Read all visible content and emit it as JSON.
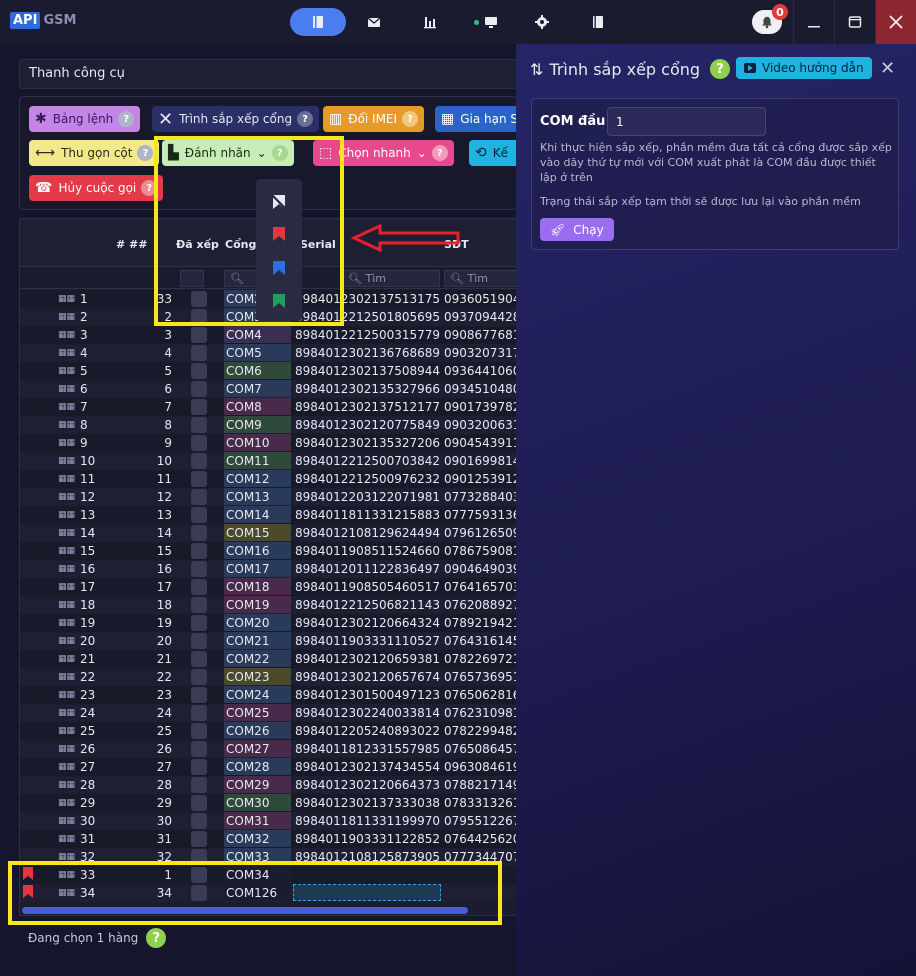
{
  "app": {
    "logo_a": "API",
    "logo_b": "GSM",
    "notifications": "0"
  },
  "toolbar": {
    "title": "Thanh công cụ"
  },
  "buttons": {
    "cmd_table": "Bảng lệnh",
    "port_sort": "Trình sắp xếp cổng",
    "change_imei": "Đổi IMEI",
    "limit": "Gia hạn S",
    "collapse": "Thu gọn cột",
    "label": "Đánh nhãn",
    "quick_select": "Chọn nhanh",
    "extra": "Kế",
    "cancel_call": "Hủy cuộc gọi",
    "help": "?"
  },
  "grid": {
    "headers": {
      "idx": "# ##",
      "sorted": "Đã xếp",
      "port": "Cổng",
      "serial": "Serial",
      "phone": "SĐT"
    },
    "search_placeholder": "Tìm",
    "rows": [
      {
        "i": "1",
        "s": "33",
        "com": "COM2",
        "serial": "8984012302137513175",
        "phone": "0936051904",
        "cc": "#2a3a5a"
      },
      {
        "i": "2",
        "s": "2",
        "com": "COM3",
        "serial": "8984012212501805695",
        "phone": "0937094428",
        "cc": "#2a3a5a"
      },
      {
        "i": "3",
        "s": "3",
        "com": "COM4",
        "serial": "8984012212500315779",
        "phone": "0908677681",
        "cc": "#3a2f50"
      },
      {
        "i": "4",
        "s": "4",
        "com": "COM5",
        "serial": "8984012302136768689",
        "phone": "0903207317",
        "cc": "#2a3a5a"
      },
      {
        "i": "5",
        "s": "5",
        "com": "COM6",
        "serial": "8984012302137508944",
        "phone": "0936441060",
        "cc": "#2f4a3a"
      },
      {
        "i": "6",
        "s": "6",
        "com": "COM7",
        "serial": "8984012302135327966",
        "phone": "0934510480",
        "cc": "#2a3a5a"
      },
      {
        "i": "7",
        "s": "7",
        "com": "COM8",
        "serial": "8984012302137512177",
        "phone": "0901739782",
        "cc": "#4a2a4a"
      },
      {
        "i": "8",
        "s": "8",
        "com": "COM9",
        "serial": "8984012302120775849",
        "phone": "0903200631",
        "cc": "#2f4a3a"
      },
      {
        "i": "9",
        "s": "9",
        "com": "COM10",
        "serial": "8984012302135327206",
        "phone": "0904543911",
        "cc": "#4a2a4a"
      },
      {
        "i": "10",
        "s": "10",
        "com": "COM11",
        "serial": "8984012212500703842",
        "phone": "0901699814",
        "cc": "#2f4a3a"
      },
      {
        "i": "11",
        "s": "11",
        "com": "COM12",
        "serial": "8984012212500976232",
        "phone": "0901253912",
        "cc": "#2a3a5a"
      },
      {
        "i": "12",
        "s": "12",
        "com": "COM13",
        "serial": "8984012203122071981",
        "phone": "0773288403",
        "cc": "#2a3a5a"
      },
      {
        "i": "13",
        "s": "13",
        "com": "COM14",
        "serial": "8984011811331215883",
        "phone": "0777593136",
        "cc": "#2a3a5a"
      },
      {
        "i": "14",
        "s": "14",
        "com": "COM15",
        "serial": "8984012108129624494",
        "phone": "0796126509",
        "cc": "#4a4a2a"
      },
      {
        "i": "15",
        "s": "15",
        "com": "COM16",
        "serial": "8984011908511524660",
        "phone": "0786759081",
        "cc": "#2a3a5a"
      },
      {
        "i": "16",
        "s": "16",
        "com": "COM17",
        "serial": "8984012011122836497",
        "phone": "0904649039",
        "cc": "#2a3a5a"
      },
      {
        "i": "17",
        "s": "17",
        "com": "COM18",
        "serial": "8984011908505460517",
        "phone": "0764165703",
        "cc": "#4a2a4a"
      },
      {
        "i": "18",
        "s": "18",
        "com": "COM19",
        "serial": "8984012212506821143",
        "phone": "0762088927",
        "cc": "#4a2a4a"
      },
      {
        "i": "19",
        "s": "19",
        "com": "COM20",
        "serial": "8984012302120664324",
        "phone": "0789219421",
        "cc": "#2a3a5a"
      },
      {
        "i": "20",
        "s": "20",
        "com": "COM21",
        "serial": "8984011903331110527",
        "phone": "0764316145",
        "cc": "#2a3a5a"
      },
      {
        "i": "21",
        "s": "21",
        "com": "COM22",
        "serial": "8984012302120659381",
        "phone": "0782269721",
        "cc": "#2a3a5a"
      },
      {
        "i": "22",
        "s": "22",
        "com": "COM23",
        "serial": "8984012302120657674",
        "phone": "0765736951",
        "cc": "#4a4a2a"
      },
      {
        "i": "23",
        "s": "23",
        "com": "COM24",
        "serial": "8984012301500497123",
        "phone": "0765062816",
        "cc": "#2a3a5a"
      },
      {
        "i": "24",
        "s": "24",
        "com": "COM25",
        "serial": "8984012302240033814",
        "phone": "0762310981",
        "cc": "#4a2a4a"
      },
      {
        "i": "25",
        "s": "25",
        "com": "COM26",
        "serial": "8984012205240893022",
        "phone": "0782299482",
        "cc": "#2a3a5a"
      },
      {
        "i": "26",
        "s": "26",
        "com": "COM27",
        "serial": "8984011812331557985",
        "phone": "0765086457",
        "cc": "#4a2a4a"
      },
      {
        "i": "27",
        "s": "27",
        "com": "COM28",
        "serial": "8984012302137434554",
        "phone": "0963084619",
        "cc": "#2a3a5a"
      },
      {
        "i": "28",
        "s": "28",
        "com": "COM29",
        "serial": "8984012302120664373",
        "phone": "0788217149",
        "cc": "#4a2a4a"
      },
      {
        "i": "29",
        "s": "29",
        "com": "COM30",
        "serial": "8984012302137333038",
        "phone": "0783313261",
        "cc": "#2f4a3a"
      },
      {
        "i": "30",
        "s": "30",
        "com": "COM31",
        "serial": "8984011811331199970",
        "phone": "0795512267",
        "cc": "#4a2a4a"
      },
      {
        "i": "31",
        "s": "31",
        "com": "COM32",
        "serial": "8984011903331122852",
        "phone": "0764425620",
        "cc": "#2a3a5a"
      },
      {
        "i": "32",
        "s": "32",
        "com": "COM33",
        "serial": "8984012108125873905",
        "phone": "0777344707",
        "cc": "#2a3a5a"
      },
      {
        "i": "33",
        "s": "1",
        "com": "COM34",
        "serial": "",
        "phone": "",
        "cc": "#1b1c30",
        "flag": true
      },
      {
        "i": "34",
        "s": "34",
        "com": "COM126",
        "serial": "",
        "phone": "",
        "cc": "#1b1c30",
        "flag": true,
        "editing": true
      }
    ]
  },
  "status": {
    "text": "Đang chọn 1 hàng",
    "help": "?"
  },
  "panel": {
    "title": "Trình sắp xếp cổng",
    "help": "?",
    "video": "Video hướng dẫn",
    "com_label": "COM đầu",
    "com_value": "1",
    "desc": "Khi thực hiện sắp xếp, phần mềm đưa tất cả cổng được sắp xếp vào dãy thứ tự mới với COM xuất phát là COM đầu được thiết lập ở trên",
    "note": "Trạng thái sắp xếp tạm thời sẽ được lưu lại vào phần mềm",
    "run": "Chạy"
  }
}
